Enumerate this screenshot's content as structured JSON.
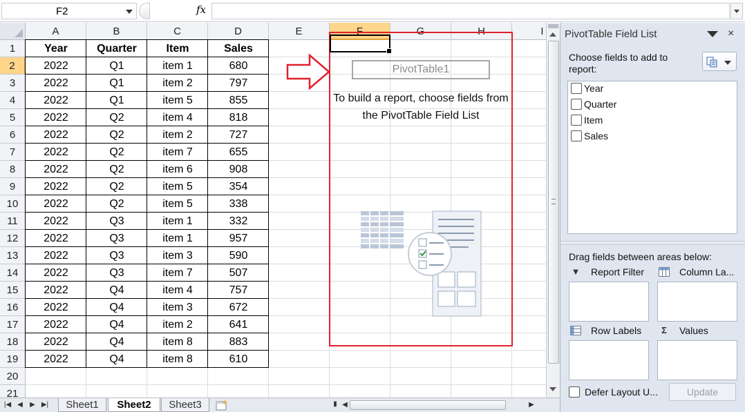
{
  "formula_bar": {
    "name_box": "F2",
    "fx_label": "fx",
    "formula": ""
  },
  "columns": [
    "A",
    "B",
    "C",
    "D",
    "E",
    "F",
    "G",
    "H",
    "I"
  ],
  "selected_column": "F",
  "selected_row": 2,
  "rows": [
    "1",
    "2",
    "3",
    "4",
    "5",
    "6",
    "7",
    "8",
    "9",
    "10",
    "11",
    "12",
    "13",
    "14",
    "15",
    "16",
    "17",
    "18",
    "19",
    "20",
    "21"
  ],
  "table": {
    "headers": [
      "Year",
      "Quarter",
      "Item",
      "Sales"
    ],
    "rows": [
      [
        "2022",
        "Q1",
        "item 1",
        "680"
      ],
      [
        "2022",
        "Q1",
        "item 2",
        "797"
      ],
      [
        "2022",
        "Q1",
        "item 5",
        "855"
      ],
      [
        "2022",
        "Q2",
        "item 4",
        "818"
      ],
      [
        "2022",
        "Q2",
        "item 2",
        "727"
      ],
      [
        "2022",
        "Q2",
        "item 7",
        "655"
      ],
      [
        "2022",
        "Q2",
        "item 6",
        "908"
      ],
      [
        "2022",
        "Q2",
        "item 5",
        "354"
      ],
      [
        "2022",
        "Q2",
        "item 5",
        "338"
      ],
      [
        "2022",
        "Q3",
        "item 1",
        "332"
      ],
      [
        "2022",
        "Q3",
        "item 1",
        "957"
      ],
      [
        "2022",
        "Q3",
        "item 3",
        "590"
      ],
      [
        "2022",
        "Q3",
        "item 7",
        "507"
      ],
      [
        "2022",
        "Q4",
        "item 4",
        "757"
      ],
      [
        "2022",
        "Q4",
        "item 3",
        "672"
      ],
      [
        "2022",
        "Q4",
        "item 2",
        "641"
      ],
      [
        "2022",
        "Q4",
        "item 8",
        "883"
      ],
      [
        "2022",
        "Q4",
        "item 8",
        "610"
      ]
    ]
  },
  "pivot": {
    "name": "PivotTable1",
    "message": "To build a report, choose fields from the PivotTable Field List",
    "highlight_color": "#e0202a"
  },
  "sheets": {
    "tabs": [
      "Sheet1",
      "Sheet2",
      "Sheet3"
    ],
    "active": "Sheet2"
  },
  "field_list": {
    "title": "PivotTable Field List",
    "close_glyph": "×",
    "choose_label": "Choose fields to add to report:",
    "fields": [
      "Year",
      "Quarter",
      "Item",
      "Sales"
    ],
    "drag_label": "Drag fields between areas below:",
    "areas": {
      "report_filter": "Report Filter",
      "column_labels": "Column La...",
      "row_labels": "Row Labels",
      "values": "Values"
    },
    "defer_label": "Defer Layout U...",
    "update_label": "Update"
  }
}
